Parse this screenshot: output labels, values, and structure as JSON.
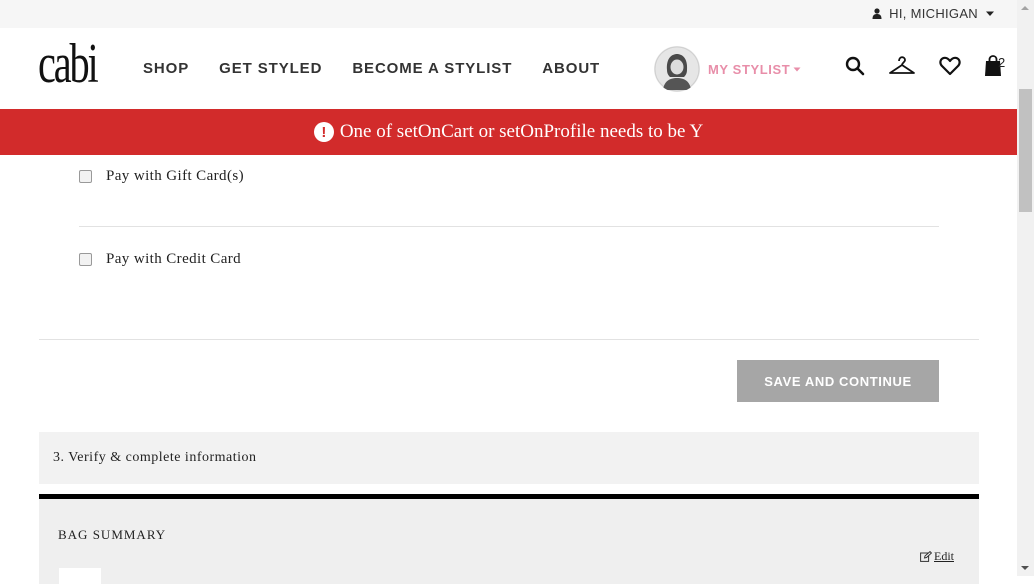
{
  "topbar": {
    "greeting": "HI, MICHIGAN"
  },
  "header": {
    "logo": "cabi",
    "nav": [
      "SHOP",
      "GET STYLED",
      "BECOME A STYLIST",
      "ABOUT"
    ],
    "stylist_label": "MY STYLIST",
    "bag_count": "2"
  },
  "alert": {
    "message": "One of setOnCart or setOnProfile needs to be Y"
  },
  "payment": {
    "gift_card_label": "Pay with Gift Card(s)",
    "credit_card_label": "Pay with Credit Card",
    "save_button": "SAVE AND CONTINUE"
  },
  "verify": {
    "label": "3. Verify & complete information"
  },
  "bag_summary": {
    "title": "BAG SUMMARY",
    "edit_label": "Edit"
  },
  "colors": {
    "alert_bg": "#d22b2b",
    "stylist_pink": "#e88ea9",
    "button_gray": "#a6a6a6"
  }
}
